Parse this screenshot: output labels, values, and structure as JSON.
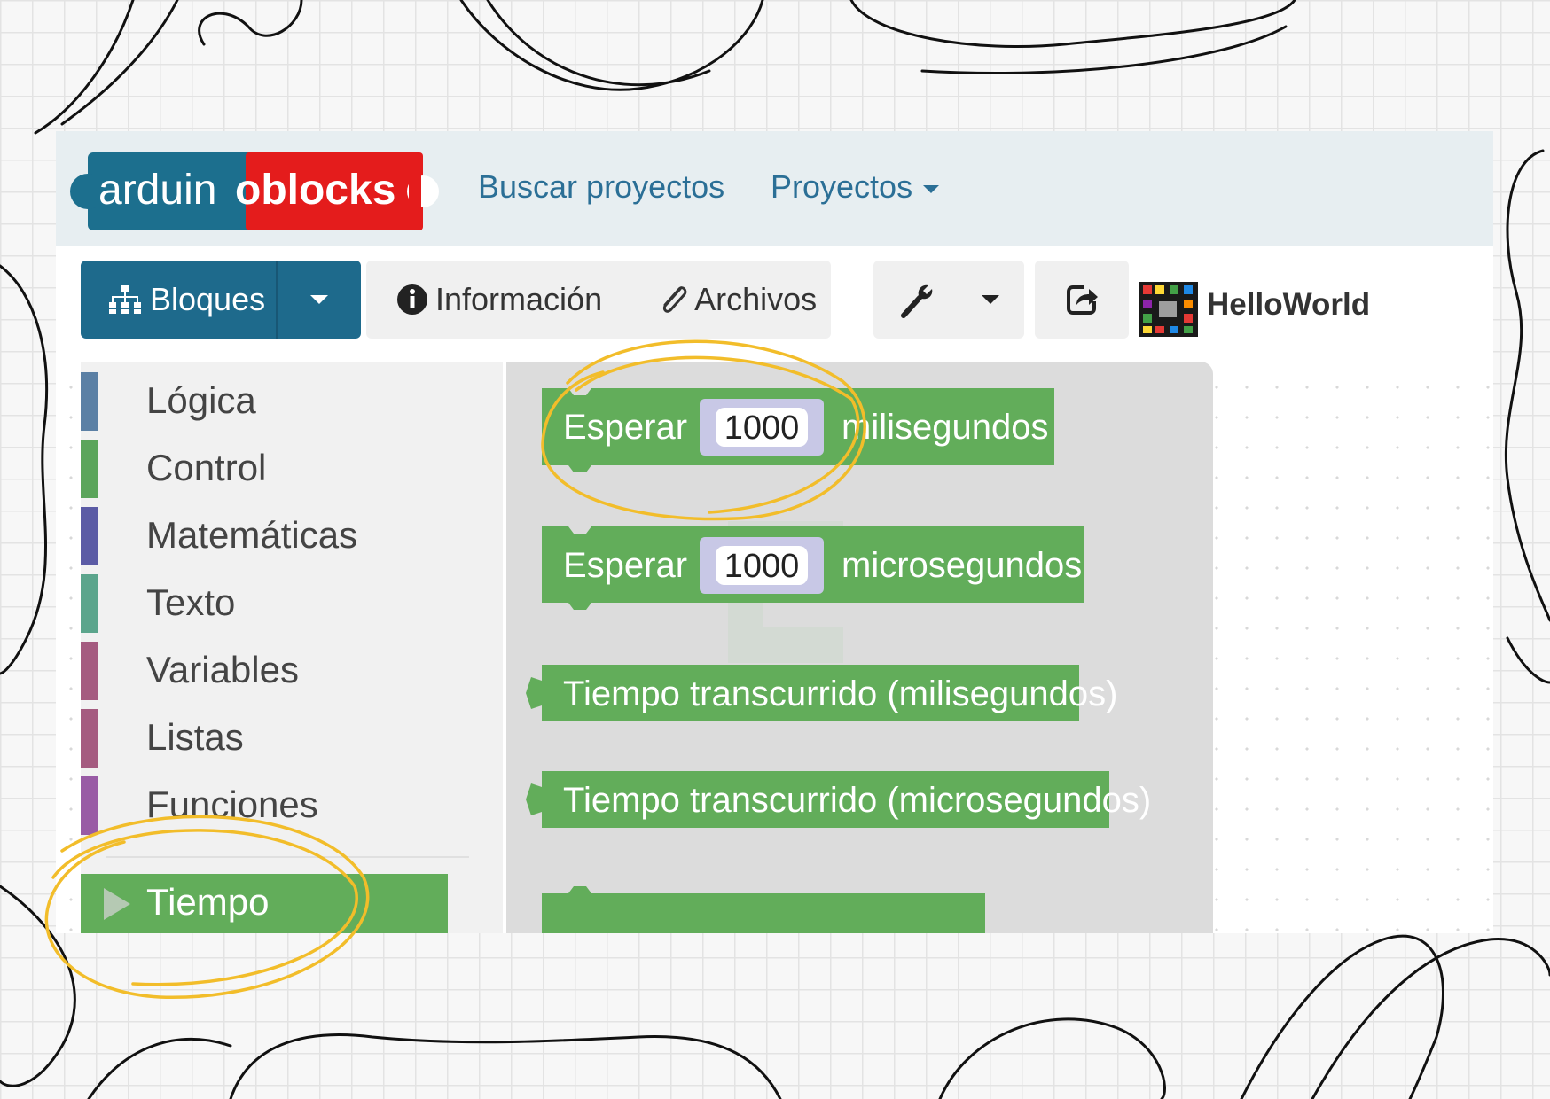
{
  "logo": {
    "text_left": "arduin",
    "text_right": "oblocks"
  },
  "navbar": {
    "links": [
      {
        "label": "Buscar proyectos"
      },
      {
        "label": "Proyectos",
        "has_dropdown": true
      }
    ]
  },
  "toolbar": {
    "bloques_label": "Bloques",
    "info_label": "Información",
    "files_label": "Archivos",
    "project_name": "HelloWorld"
  },
  "categories": [
    {
      "label": "Lógica",
      "color": "#5b80a5"
    },
    {
      "label": "Control",
      "color": "#5ba55b"
    },
    {
      "label": "Matemáticas",
      "color": "#5b5ba5"
    },
    {
      "label": "Texto",
      "color": "#5ba58c"
    },
    {
      "label": "Variables",
      "color": "#a55b80"
    },
    {
      "label": "Listas",
      "color": "#a55b80"
    },
    {
      "label": "Funciones",
      "color": "#995ba5"
    }
  ],
  "selected_category": {
    "label": "Tiempo",
    "color": "#62ad5a"
  },
  "blocks": [
    {
      "prefix": "Esperar",
      "value": "1000",
      "suffix": "milisegundos"
    },
    {
      "prefix": "Esperar",
      "value": "1000",
      "suffix": "microsegundos"
    },
    {
      "label": "Tiempo transcurrido (milisegundos)"
    },
    {
      "label": "Tiempo transcurrido (microsegundos)"
    }
  ],
  "colors": {
    "block_green": "#62ad5a",
    "navbar_bg": "#e7eef1",
    "primary_button": "#1e6a8c",
    "highlight_circle": "#f2bd2a",
    "link": "#2b6f96"
  }
}
